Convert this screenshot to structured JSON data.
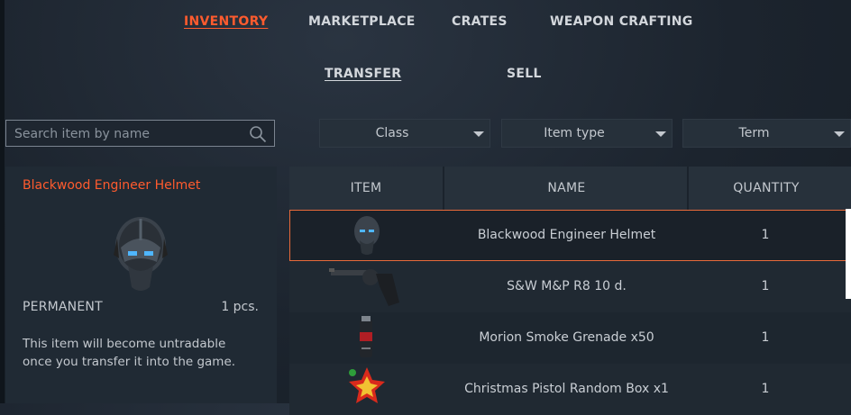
{
  "nav": {
    "main_tabs": [
      {
        "label": "INVENTORY",
        "active": true
      },
      {
        "label": "MARKETPLACE",
        "active": false
      },
      {
        "label": "CRATES",
        "active": false
      },
      {
        "label": "WEAPON CRAFTING",
        "active": false
      }
    ],
    "sub_tabs": [
      {
        "label": "TRANSFER",
        "active": true
      },
      {
        "label": "SELL",
        "active": false
      }
    ]
  },
  "search": {
    "placeholder": "Search item by name",
    "value": ""
  },
  "filters": [
    {
      "label": "Class"
    },
    {
      "label": "Item type"
    },
    {
      "label": "Term"
    }
  ],
  "details": {
    "name": "Blackwood Engineer Helmet",
    "term": "PERMANENT",
    "quantity": "1 pcs.",
    "note": "This item will become untradable once you transfer it into the game."
  },
  "table": {
    "columns": [
      "ITEM",
      "NAME",
      "QUANTITY"
    ],
    "rows": [
      {
        "name": "Blackwood Engineer Helmet",
        "quantity": "1",
        "icon": "helmet-icon",
        "selected": true
      },
      {
        "name": "S&W M&P R8 10 d.",
        "quantity": "1",
        "icon": "revolver-icon",
        "selected": false
      },
      {
        "name": "Morion Smoke Grenade x50",
        "quantity": "1",
        "icon": "grenade-icon",
        "selected": false
      },
      {
        "name": "Christmas Pistol Random Box x1",
        "quantity": "1",
        "icon": "gift-box-icon",
        "selected": false
      }
    ]
  },
  "colors": {
    "accent": "#ff5b2e",
    "selection_border": "#e86a3a"
  }
}
